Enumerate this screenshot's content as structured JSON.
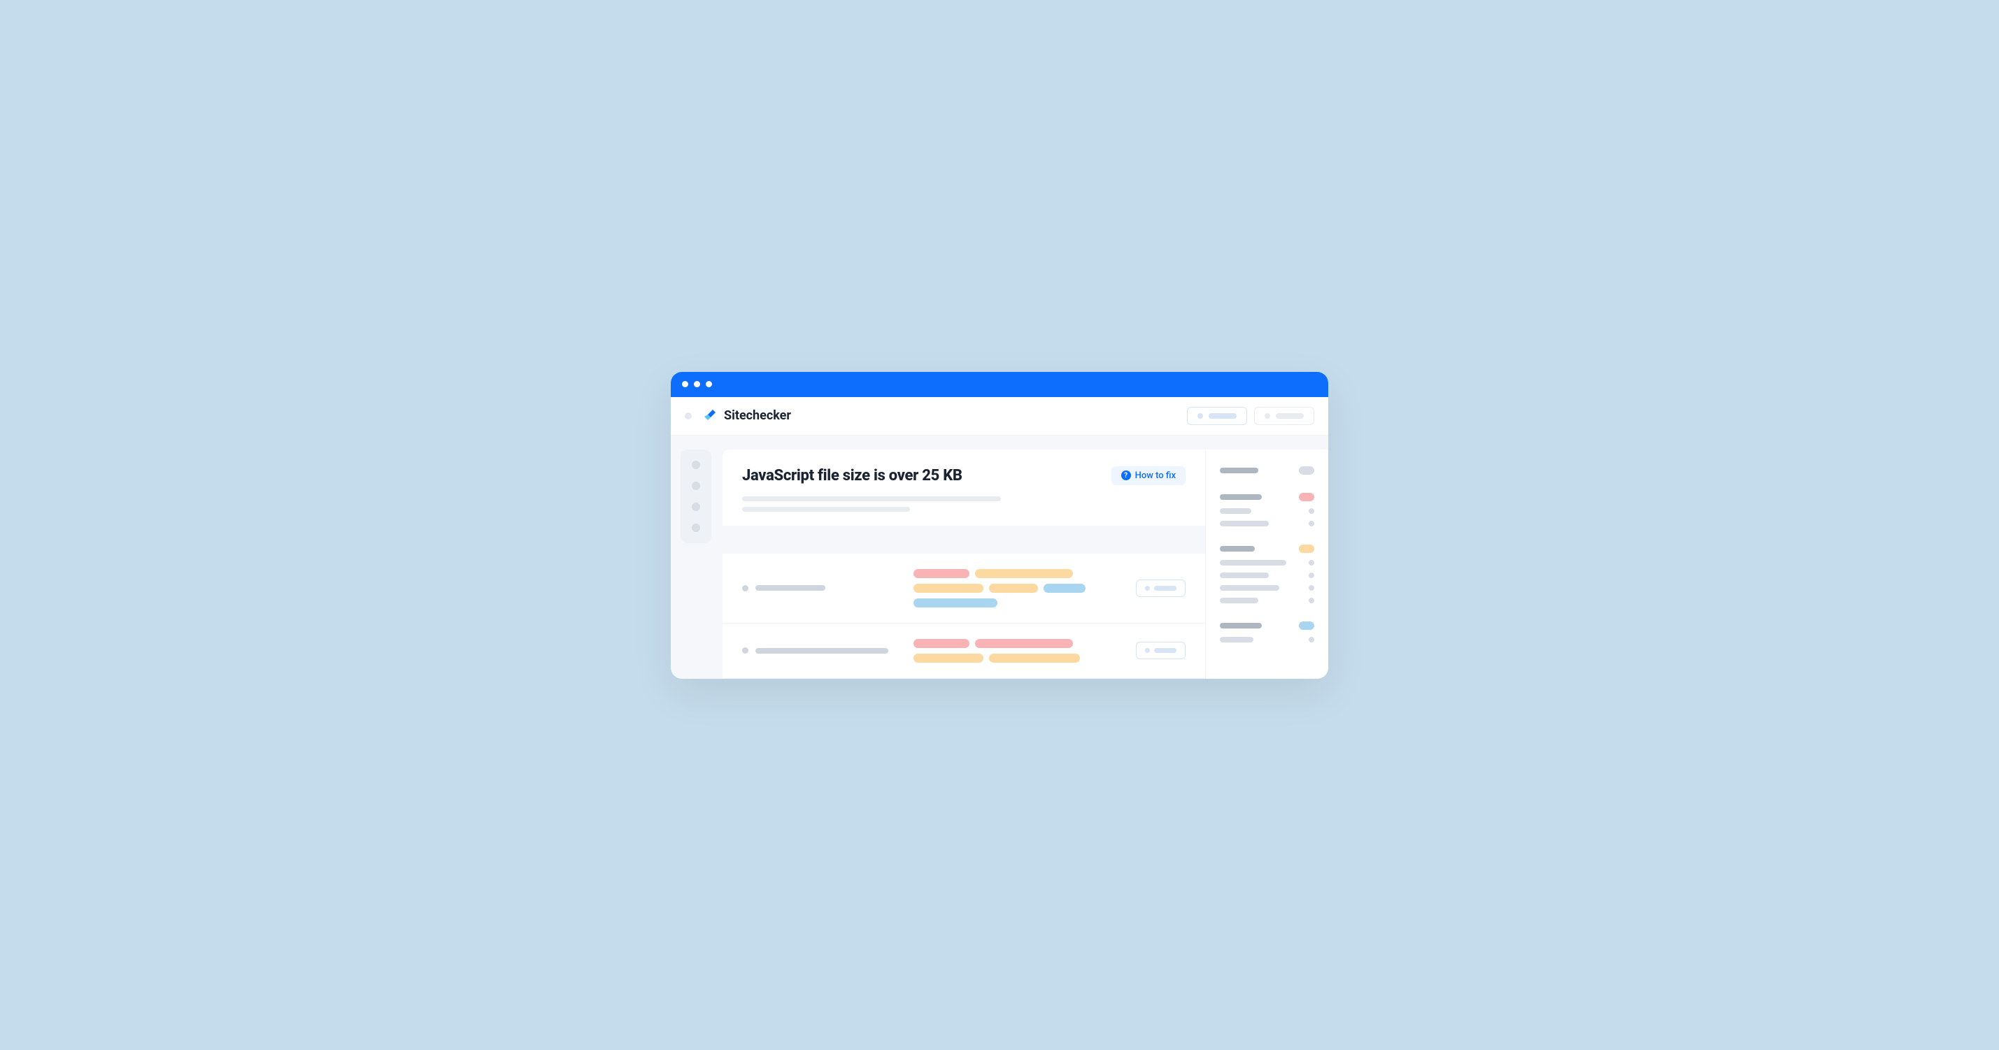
{
  "brand": {
    "name": "Sitechecker"
  },
  "issue": {
    "title": "JavaScript file size is over 25 KB",
    "howToFix": "How to fix"
  }
}
